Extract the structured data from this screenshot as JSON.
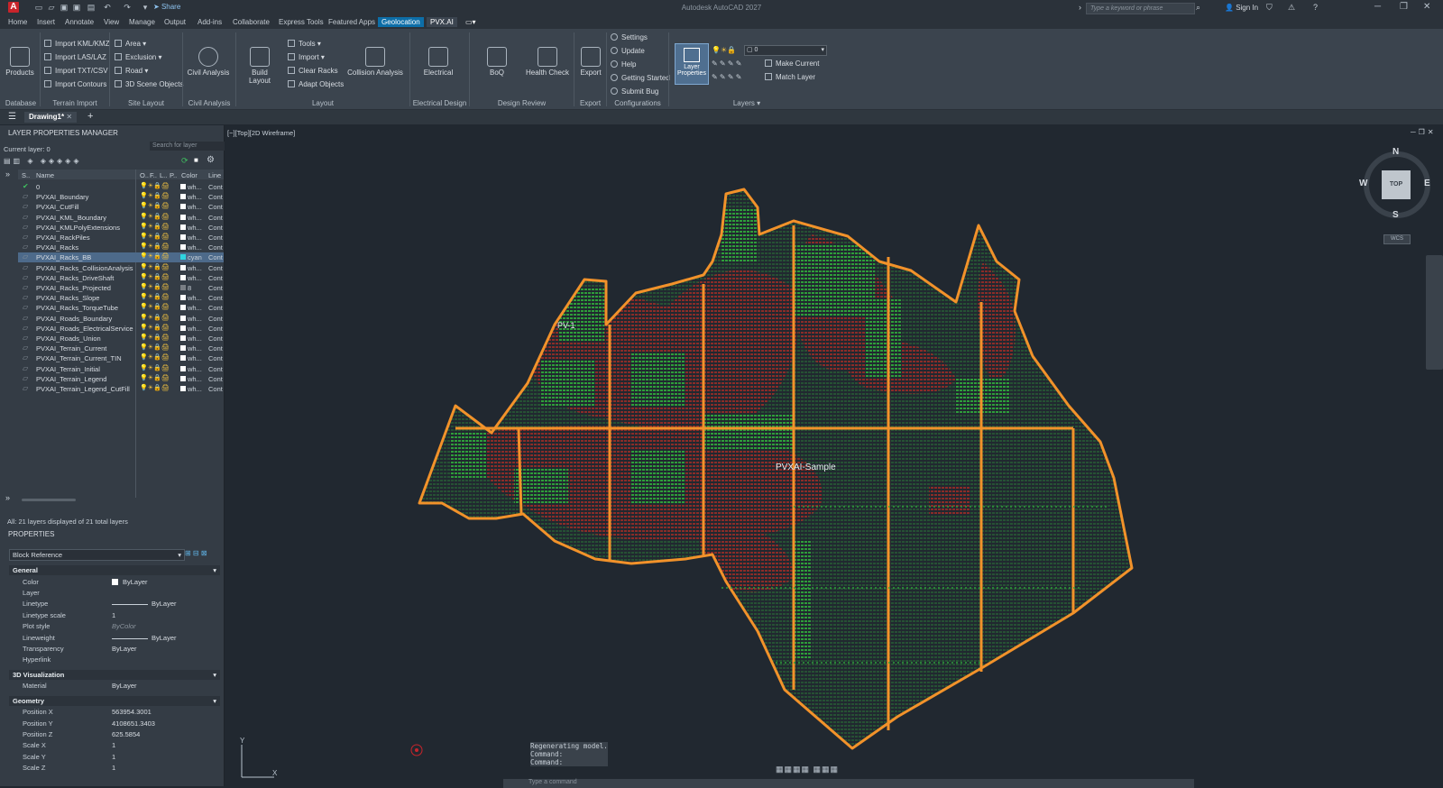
{
  "app": {
    "title": "Autodesk AutoCAD 2027",
    "logo": "A",
    "share": "Share",
    "search_placeholder": "Type a keyword or phrase",
    "sign_in": "Sign In"
  },
  "tabs": [
    "Home",
    "Insert",
    "Annotate",
    "View",
    "Manage",
    "Output",
    "Add-ins",
    "Collaborate",
    "Express Tools",
    "Featured Apps",
    "Geolocation",
    "PVX.AI"
  ],
  "active_tab": "Geolocation",
  "ribbon": {
    "products": "Products",
    "terrain_import": [
      "Import KML/KMZ",
      "Import LAS/LAZ",
      "Import TXT/CSV",
      "Import Contours"
    ],
    "site_layout": [
      "Area",
      "Exclusion",
      "Road",
      "3D Scene Objects"
    ],
    "civil_analysis": "Civil Analysis",
    "build_layout": "Build Layout",
    "layout_tools": [
      "Tools",
      "Import",
      "Clear Racks",
      "Adapt Objects"
    ],
    "collision_analysis": "Collision Analysis",
    "electrical": "Electrical",
    "boq": "BoQ",
    "health_check": "Health Check",
    "export": "Export",
    "configurations": [
      "Settings",
      "Update",
      "Help",
      "Getting Started",
      "Submit Bug"
    ],
    "layer_properties": "Layer Properties",
    "current_layer_value": "0",
    "make_current": "Make Current",
    "match_layer": "Match Layer",
    "panel_labels": [
      "Database",
      "Terrain Import",
      "Site Layout",
      "Civil Analysis",
      "Layout",
      "Electrical Design",
      "Design Review",
      "Export",
      "Configurations",
      "Layers"
    ]
  },
  "doc_tab": "Drawing1*",
  "layer_manager": {
    "title": "LAYER PROPERTIES MANAGER",
    "current_layer": "Current layer: 0",
    "search_placeholder": "Search for layer",
    "columns": {
      "status": "S..",
      "name": "Name",
      "on": "O..",
      "freeze": "F..",
      "lock": "L..",
      "plot": "P..",
      "color": "Color",
      "linetype": "Line"
    },
    "layers": [
      {
        "name": "0",
        "color": "wh...",
        "line": "Cont",
        "current": true
      },
      {
        "name": "PVXAI_Boundary",
        "color": "wh...",
        "line": "Cont"
      },
      {
        "name": "PVXAI_CutFill",
        "color": "wh...",
        "line": "Cont"
      },
      {
        "name": "PVXAI_KML_Boundary",
        "color": "wh...",
        "line": "Cont"
      },
      {
        "name": "PVXAI_KMLPolyExtensions",
        "color": "wh...",
        "line": "Cont"
      },
      {
        "name": "PVXAI_RackPiles",
        "color": "wh...",
        "line": "Cont"
      },
      {
        "name": "PVXAI_Racks",
        "color": "wh...",
        "line": "Cont"
      },
      {
        "name": "PVXAI_Racks_BB",
        "color": "cyan",
        "line": "Cont",
        "selected": true
      },
      {
        "name": "PVXAI_Racks_CollisionAnalysis",
        "color": "wh...",
        "line": "Cont"
      },
      {
        "name": "PVXAI_Racks_DriveShaft",
        "color": "wh...",
        "line": "Cont"
      },
      {
        "name": "PVXAI_Racks_Projected",
        "color": "8",
        "line": "Cont"
      },
      {
        "name": "PVXAI_Racks_Slope",
        "color": "wh...",
        "line": "Cont"
      },
      {
        "name": "PVXAI_Racks_TorqueTube",
        "color": "wh...",
        "line": "Cont"
      },
      {
        "name": "PVXAI_Roads_Boundary",
        "color": "wh...",
        "line": "Cont"
      },
      {
        "name": "PVXAI_Roads_ElectricalService",
        "color": "wh...",
        "line": "Cont"
      },
      {
        "name": "PVXAI_Roads_Union",
        "color": "wh...",
        "line": "Cont"
      },
      {
        "name": "PVXAI_Terrain_Current",
        "color": "wh...",
        "line": "Cont"
      },
      {
        "name": "PVXAI_Terrain_Current_TIN",
        "color": "wh...",
        "line": "Cont"
      },
      {
        "name": "PVXAI_Terrain_Initial",
        "color": "wh...",
        "line": "Cont"
      },
      {
        "name": "PVXAI_Terrain_Legend",
        "color": "wh...",
        "line": "Cont"
      },
      {
        "name": "PVXAI_Terrain_Legend_CutFill",
        "color": "wh...",
        "line": "Cont"
      }
    ],
    "status": "All: 21 layers displayed of 21 total layers"
  },
  "properties": {
    "title": "PROPERTIES",
    "object_type": "Block Reference",
    "sections": [
      {
        "name": "General",
        "rows": [
          {
            "key": "Color",
            "value": "ByLayer"
          },
          {
            "key": "Layer",
            "value": ""
          },
          {
            "key": "Linetype",
            "value": "ByLayer"
          },
          {
            "key": "Linetype scale",
            "value": "1"
          },
          {
            "key": "Plot style",
            "value": "ByColor"
          },
          {
            "key": "Lineweight",
            "value": "ByLayer"
          },
          {
            "key": "Transparency",
            "value": "ByLayer"
          },
          {
            "key": "Hyperlink",
            "value": ""
          }
        ]
      },
      {
        "name": "3D Visualization",
        "rows": [
          {
            "key": "Material",
            "value": "ByLayer"
          }
        ]
      },
      {
        "name": "Geometry",
        "rows": [
          {
            "key": "Position X",
            "value": "563954.3001"
          },
          {
            "key": "Position Y",
            "value": "4108651.3403"
          },
          {
            "key": "Position Z",
            "value": "625.5854"
          },
          {
            "key": "Scale X",
            "value": "1"
          },
          {
            "key": "Scale Y",
            "value": "1"
          },
          {
            "key": "Scale Z",
            "value": "1"
          }
        ]
      }
    ]
  },
  "viewport": {
    "label": "[−][Top][2D Wireframe]",
    "text_pv1": "PV-1",
    "text_sample": "PVXAI-Sample",
    "viewcube": {
      "n": "N",
      "s": "S",
      "e": "E",
      "w": "W",
      "face": "TOP",
      "wcs": "WCS"
    },
    "ucs_x": "X",
    "ucs_y": "Y"
  },
  "command": {
    "history": [
      "Regenerating model.",
      "Command:",
      "Command:"
    ],
    "placeholder": "Type a command"
  },
  "colors": {
    "boundary": "#f2922a",
    "fill_green": "#2e9e3a",
    "cut_red": "#8b2c28",
    "accent": "#0d6ea8"
  }
}
